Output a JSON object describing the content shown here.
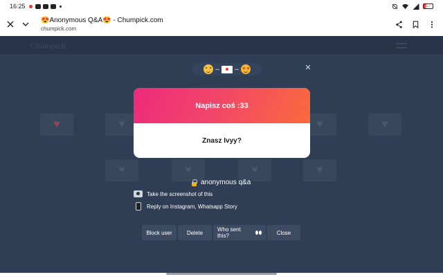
{
  "status_bar": {
    "time": "16:25",
    "battery": "17"
  },
  "browser": {
    "title": "😍Anonymous Q&A😍 - Chumpick.com",
    "url": "chumpick.com"
  },
  "background": {
    "logo": "ChumpicK"
  },
  "emoji_bar": {
    "dash": "--"
  },
  "question_card": {
    "header": "Napisz coś :33",
    "answer": "Znasz Ivyy?"
  },
  "info": {
    "anonymous_label": "anonymous q&a",
    "tip_screenshot": "Take the screenshot of this",
    "tip_reply": "Reply on Instagram, Whatsapp Story"
  },
  "actions": {
    "block": "Block user",
    "delete": "Delete",
    "who_sent": "Who sent this?",
    "close": "Close"
  },
  "colors": {
    "page_bg": "#2f3e55",
    "gradient_start": "#ee2a7b",
    "gradient_end": "#f96a3c",
    "button_bg": "#3d4b62"
  }
}
